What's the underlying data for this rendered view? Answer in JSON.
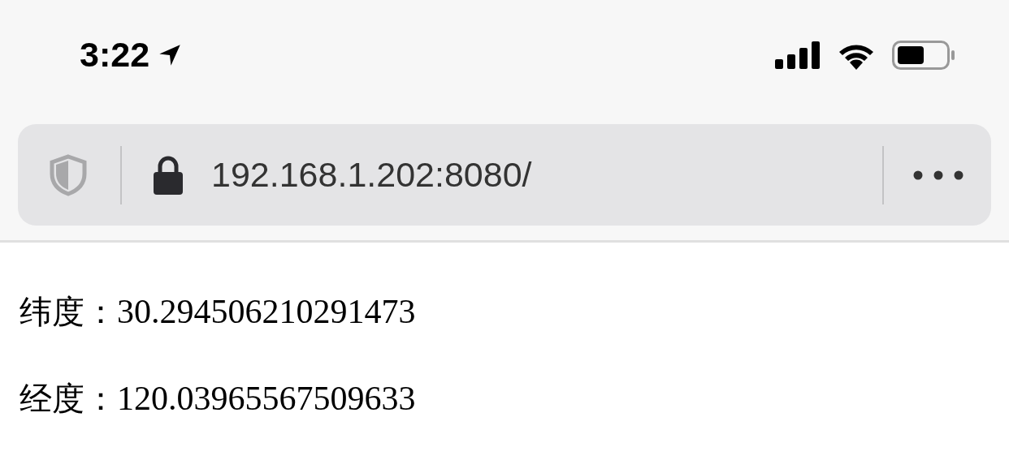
{
  "status_bar": {
    "time": "3:22"
  },
  "address_bar": {
    "url": "192.168.1.202:8080/"
  },
  "lines": [
    {
      "label": "纬度：",
      "value": "30.294506210291473"
    },
    {
      "label": "经度：",
      "value": "120.03965567509633"
    }
  ]
}
